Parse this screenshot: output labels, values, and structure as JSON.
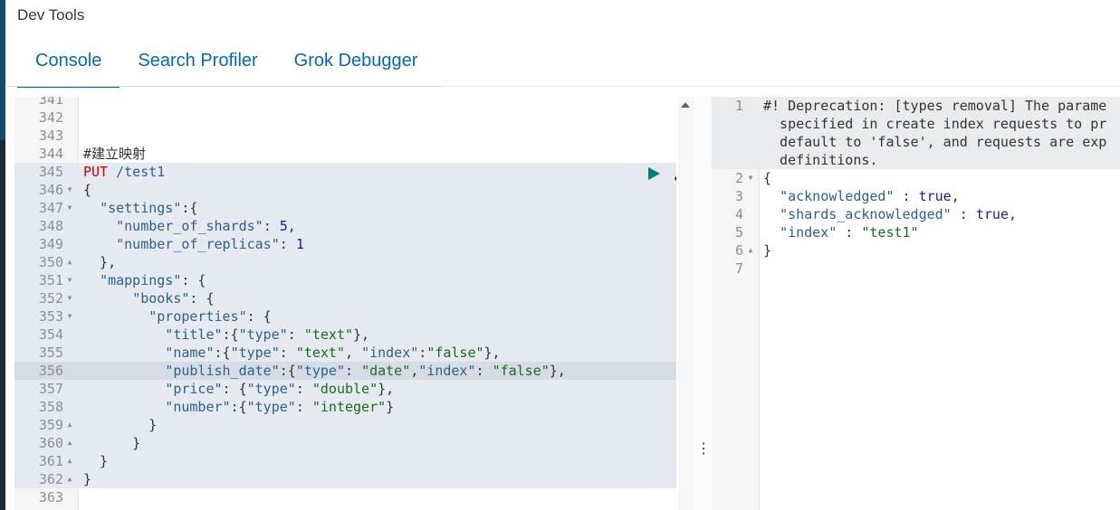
{
  "app": {
    "title": "Dev Tools"
  },
  "tabs": [
    {
      "label": "Console",
      "active": true
    },
    {
      "label": "Search Profiler",
      "active": false
    },
    {
      "label": "Grok Debugger",
      "active": false
    }
  ],
  "editor": {
    "line_numbers": [
      "341",
      "342",
      "343",
      "344",
      "345",
      "346",
      "347",
      "348",
      "349",
      "350",
      "351",
      "352",
      "353",
      "354",
      "355",
      "356",
      "357",
      "358",
      "359",
      "360",
      "361",
      "362",
      "363"
    ],
    "lines": {
      "comment": "#建立映射",
      "method": "PUT",
      "path": "/test1",
      "brace_open": "{",
      "settings_key": "\"settings\"",
      "shards_key": "\"number_of_shards\"",
      "shards_val": "5",
      "replicas_key": "\"number_of_replicas\"",
      "replicas_val": "1",
      "mappings_key": "\"mappings\"",
      "books_key": "\"books\"",
      "properties_key": "\"properties\"",
      "title_key": "\"title\"",
      "name_key": "\"name\"",
      "publish_date_key": "\"publish_date\"",
      "price_key": "\"price\"",
      "number_key": "\"number\"",
      "type_key": "\"type\"",
      "index_key": "\"index\"",
      "v_text": "\"text\"",
      "v_false": "\"false\"",
      "v_date": "\"date\"",
      "v_double": "\"double\"",
      "v_integer": "\"integer\"",
      "brace_close": "}"
    },
    "actions": {
      "run_icon": "play-icon",
      "settings_icon": "wrench-icon"
    }
  },
  "output": {
    "line_numbers": [
      "1",
      "2",
      "3",
      "4",
      "5",
      "6",
      "7"
    ],
    "warning_lines": [
      "#! Deprecation: [types removal] The parame",
      "  specified in create index requests to pr",
      "  default to 'false', and requests are exp",
      "  definitions."
    ],
    "ack_key": "\"acknowledged\"",
    "shards_ack_key": "\"shards_acknowledged\"",
    "index_key": "\"index\"",
    "true_val": "true",
    "index_val": "\"test1\"",
    "brace_open": "{",
    "brace_close": "}"
  },
  "colors": {
    "accent": "#006bb4",
    "keyword": "#c80000",
    "run": "#017d73"
  }
}
